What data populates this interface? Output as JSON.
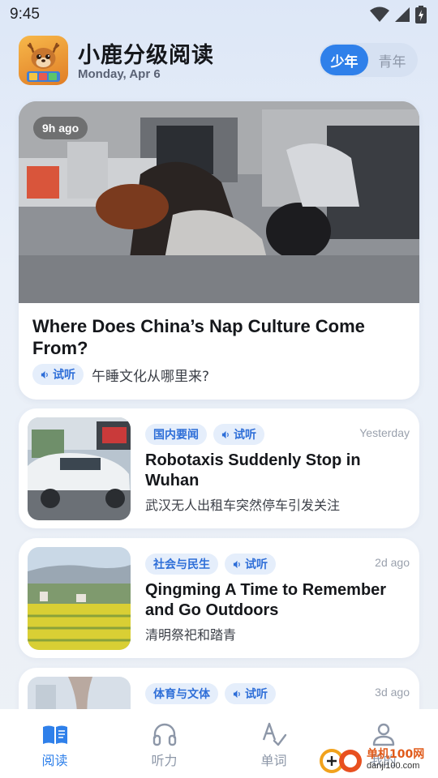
{
  "status_bar": {
    "time": "9:45"
  },
  "header": {
    "title": "小鹿分级阅读",
    "date": "Monday, Apr 6",
    "level_options": [
      "少年",
      "青年"
    ],
    "selected_level": "少年",
    "logo_text": "ABC"
  },
  "featured": {
    "time": "9h ago",
    "title": "Where Does China’s Nap Culture Come From?",
    "listen_label": "试听",
    "subtitle": "午睡文化从哪里来?"
  },
  "articles": [
    {
      "category": "国内要闻",
      "listen_label": "试听",
      "time": "Yesterday",
      "title": "Robotaxis Suddenly Stop in Wuhan",
      "subtitle": "武汉无人出租车突然停车引发关注"
    },
    {
      "category": "社会与民生",
      "listen_label": "试听",
      "time": "2d ago",
      "title": "Qingming A Time to Remember and Go Outdoors",
      "subtitle": "清明祭祀和踏青"
    },
    {
      "category": "体育与文体",
      "listen_label": "试听",
      "time": "3d ago",
      "title": "",
      "subtitle": ""
    }
  ],
  "bottom_nav": [
    {
      "label": "阅读",
      "icon": "book-icon",
      "active": true
    },
    {
      "label": "听力",
      "icon": "headphones-icon",
      "active": false
    },
    {
      "label": "单词",
      "icon": "spell-check-icon",
      "active": false
    },
    {
      "label": "我的",
      "icon": "person-icon",
      "active": false
    }
  ],
  "watermark": {
    "text": "单机100网",
    "url": "danji100.com"
  },
  "colors": {
    "accent": "#2f80ea",
    "pill_bg": "#e5eefb",
    "muted": "#8d97a8"
  }
}
